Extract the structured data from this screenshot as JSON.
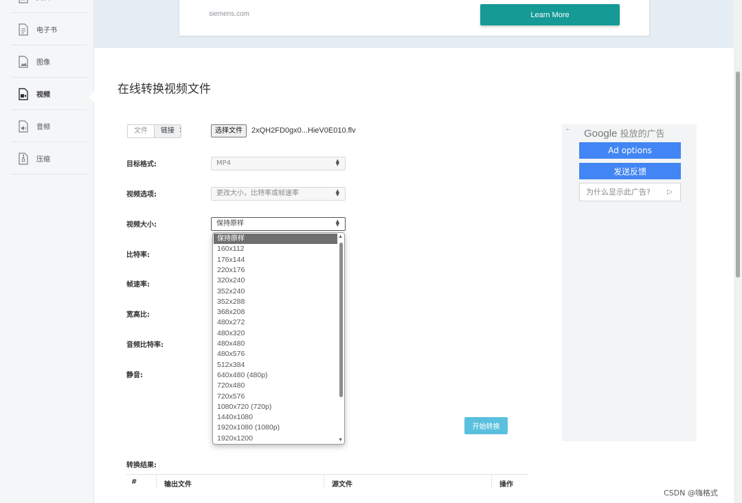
{
  "sidebar": {
    "items": [
      {
        "label": "文档",
        "icon": "word-doc-icon"
      },
      {
        "label": "电子书",
        "icon": "ebook-icon"
      },
      {
        "label": "图像",
        "icon": "image-icon"
      },
      {
        "label": "视频",
        "icon": "video-file-icon",
        "active": true
      },
      {
        "label": "音频",
        "icon": "audio-file-icon"
      },
      {
        "label": "压缩",
        "icon": "archive-file-icon"
      }
    ]
  },
  "banner": {
    "url": "siemens.com",
    "cta": "Learn More",
    "cta_color": "#159a96"
  },
  "main": {
    "title": "在线转换视频文件",
    "source_tabs": [
      "文件",
      "链接"
    ],
    "tabs_colon": ":",
    "choose_file_label": "选择文件",
    "file_name": "2xQH2FD0gx0...HieV0E010.flv",
    "labels": {
      "target_format": "目标格式:",
      "video_options": "视频选项:",
      "video_size": "视频大小:",
      "bitrate": "比特率:",
      "frame_rate": "帧速率:",
      "aspect_ratio": "宽高比:",
      "audio_bitrate": "音频比特率:",
      "mute": "静音:"
    },
    "selects": {
      "target_format": "MP4",
      "video_options": "更改大小，比特率或帧速率",
      "video_size": "保持原样"
    },
    "video_size_options": [
      "保持原样",
      "160x112",
      "176x144",
      "220x176",
      "320x240",
      "352x240",
      "352x288",
      "368x208",
      "480x272",
      "480x320",
      "480x480",
      "480x576",
      "512x384",
      "640x480 (480p)",
      "720x480",
      "720x576",
      "1080x720 (720p)",
      "1440x1080",
      "1920x1080 (1080p)",
      "1920x1200"
    ],
    "start_button": "开始转换",
    "start_button_color": "#5bc0de",
    "result_label": "转换结果:",
    "result_columns": [
      "#",
      "输出文件",
      "源文件",
      "操作"
    ]
  },
  "ad": {
    "back_arrow": "←",
    "google": "Google",
    "google_suffix": "投放的广告",
    "ad_options": "Ad options",
    "feedback": "发送反馈",
    "why": "为什么显示此广告?",
    "why_icon": "▷",
    "button_color": "#4285f4"
  },
  "watermark": "CSDN @嗨格式"
}
